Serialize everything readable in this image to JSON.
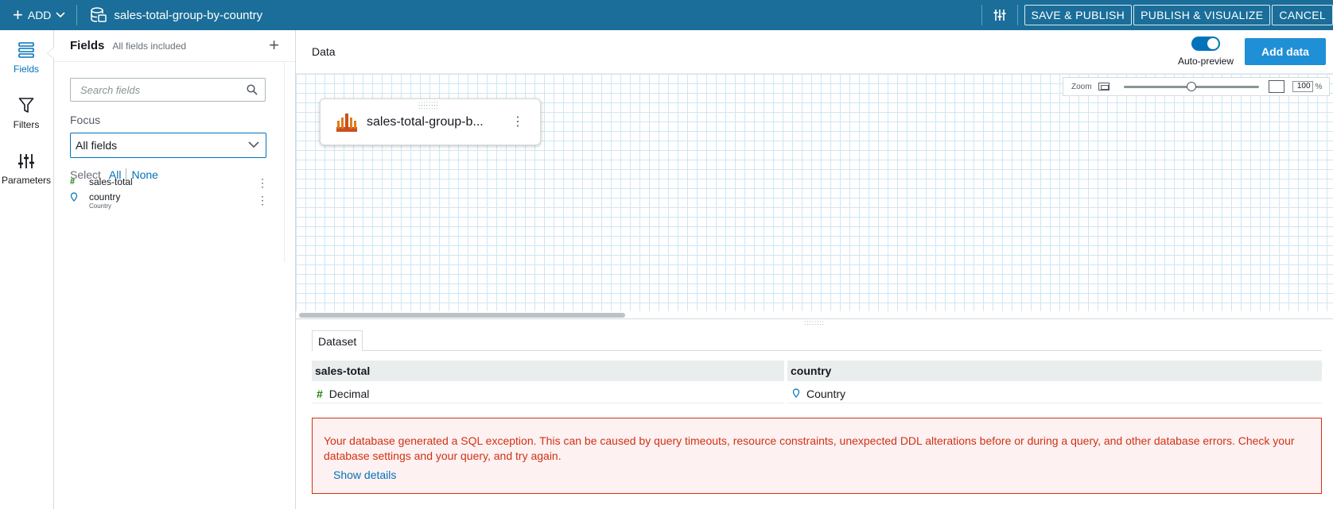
{
  "topbar": {
    "add_label": "ADD",
    "dataset_name": "sales-total-group-by-country",
    "save_publish": "SAVE & PUBLISH",
    "publish_visualize": "PUBLISH & VISUALIZE",
    "cancel": "CANCEL",
    "bg_color": "#1a6e99"
  },
  "rail": {
    "items": [
      {
        "label": "Fields",
        "icon": "fields-icon",
        "active": true
      },
      {
        "label": "Filters",
        "icon": "filter-icon"
      },
      {
        "label": "Parameters",
        "icon": "parameters-icon"
      }
    ]
  },
  "fields_panel": {
    "title": "Fields",
    "subtitle": "All fields included",
    "search_placeholder": "Search fields",
    "focus_label": "Focus",
    "focus_value": "All fields",
    "select_label": "Select",
    "select_all": "All",
    "select_none": "None",
    "fields": [
      {
        "type_symbol": "#",
        "name": "sales-total",
        "sub": ""
      },
      {
        "type_symbol": "geo",
        "name": "country",
        "sub": "Country"
      }
    ]
  },
  "main": {
    "data_title": "Data",
    "auto_preview_label": "Auto-preview",
    "auto_preview_on": true,
    "add_data_label": "Add data",
    "zoom": {
      "label": "Zoom",
      "value": "100",
      "unit": "%",
      "level": 0.5
    },
    "node_label": "sales-total-group-b...",
    "tab_dataset": "Dataset",
    "table": {
      "columns": [
        "sales-total",
        "country"
      ],
      "types": [
        {
          "symbol": "#",
          "label": "Decimal"
        },
        {
          "symbol": "geo",
          "label": "Country"
        }
      ]
    },
    "error": {
      "message": "Your database generated a SQL exception. This can be caused by query timeouts, resource constraints, unexpected DDL alterations before or during a query, and other database errors. Check your database settings and your query, and try again.",
      "details_link": "Show details"
    }
  }
}
